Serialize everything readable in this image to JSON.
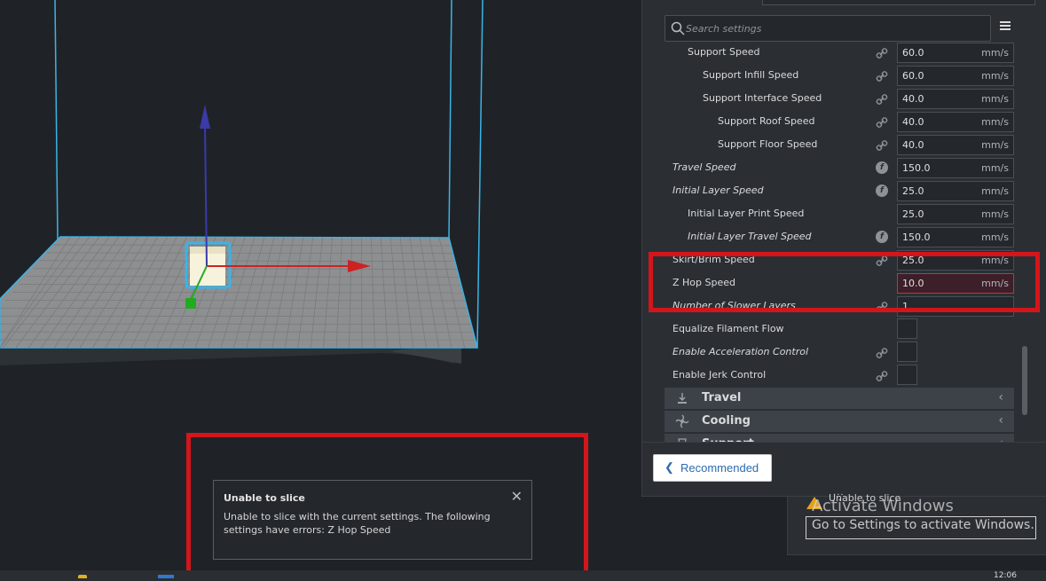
{
  "settings_panel": {
    "search_placeholder": "Search settings",
    "rows": [
      {
        "label": "Support Speed",
        "value": "60.0",
        "unit": "mm/s",
        "italic": false,
        "indent": 2,
        "icon": "link-icon"
      },
      {
        "label": "Support Infill Speed",
        "value": "60.0",
        "unit": "mm/s",
        "italic": false,
        "indent": 3,
        "icon": "link-icon"
      },
      {
        "label": "Support Interface Speed",
        "value": "40.0",
        "unit": "mm/s",
        "italic": false,
        "indent": 3,
        "icon": "link-icon"
      },
      {
        "label": "Support Roof Speed",
        "value": "40.0",
        "unit": "mm/s",
        "italic": false,
        "indent": 4,
        "icon": "link-icon"
      },
      {
        "label": "Support Floor Speed",
        "value": "40.0",
        "unit": "mm/s",
        "italic": false,
        "indent": 4,
        "icon": "link-icon"
      },
      {
        "label": "Travel Speed",
        "value": "150.0",
        "unit": "mm/s",
        "italic": true,
        "indent": 1,
        "icon": "function-icon"
      },
      {
        "label": "Initial Layer Speed",
        "value": "25.0",
        "unit": "mm/s",
        "italic": true,
        "indent": 1,
        "icon": "function-icon"
      },
      {
        "label": "Initial Layer Print Speed",
        "value": "25.0",
        "unit": "mm/s",
        "italic": false,
        "indent": 2,
        "icon": ""
      },
      {
        "label": "Initial Layer Travel Speed",
        "value": "150.0",
        "unit": "mm/s",
        "italic": true,
        "indent": 2,
        "icon": "function-icon"
      },
      {
        "label": "Skirt/Brim Speed",
        "value": "25.0",
        "unit": "mm/s",
        "italic": false,
        "indent": 1,
        "icon": "link-icon"
      },
      {
        "label": "Z Hop Speed",
        "value": "10.0",
        "unit": "mm/s",
        "italic": false,
        "indent": 1,
        "icon": "",
        "error": true
      },
      {
        "label": "Number of Slower Layers",
        "value": "1",
        "unit": "",
        "italic": true,
        "indent": 1,
        "icon": "link-icon"
      },
      {
        "label": "Equalize Filament Flow",
        "checkbox": true,
        "italic": false,
        "indent": 1,
        "icon": ""
      },
      {
        "label": "Enable Acceleration Control",
        "checkbox": true,
        "italic": true,
        "indent": 1,
        "icon": "link-icon"
      },
      {
        "label": "Enable Jerk Control",
        "checkbox": true,
        "italic": false,
        "indent": 1,
        "icon": "link-icon"
      }
    ],
    "categories": [
      {
        "label": "Travel",
        "icon": "travel-icon"
      },
      {
        "label": "Cooling",
        "icon": "fan-icon"
      },
      {
        "label": "Support",
        "icon": "support-icon"
      }
    ],
    "recommended_label": "Recommended"
  },
  "slice_panel": {
    "status": "Unable to slice",
    "dots": "..."
  },
  "error_dialog": {
    "title": "Unable to slice",
    "message": "Unable to slice with the current settings. The following settings have errors: Z Hop Speed"
  },
  "watermark": {
    "title": "Activate Windows",
    "subtitle": "Go to Settings to activate Windows."
  },
  "taskbar": {
    "clock": "12:06"
  },
  "colors": {
    "annotation": "#d4151b",
    "error_field": "#c6323a",
    "axis_x": "#cc2222",
    "axis_y": "#3a3aa8",
    "axis_z": "#22aa22",
    "build_volume": "#3ab4e6"
  }
}
